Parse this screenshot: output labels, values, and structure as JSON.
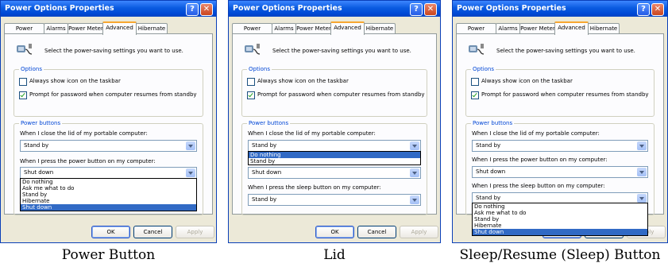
{
  "dialog_title": "Power Options Properties",
  "help_glyph": "?",
  "close_glyph": "✕",
  "tabs": [
    "Power Schemes",
    "Alarms",
    "Power Meter",
    "Advanced",
    "Hibernate"
  ],
  "active_tab": "Advanced",
  "intro_text": "Select the power-saving settings you want to use.",
  "options_label": "Options",
  "checkbox_taskbar": "Always show icon on the taskbar",
  "checkbox_password": "Prompt for password when computer resumes from standby",
  "power_buttons_label": "Power buttons",
  "lid_label": "When I close the lid of my portable computer:",
  "power_label": "When I press the power button on my computer:",
  "sleep_label": "When I press the sleep button on my computer:",
  "ok_label": "OK",
  "cancel_label": "Cancel",
  "apply_label": "Apply",
  "panels": [
    {
      "caption": "Power Button",
      "lid_value": "Stand by",
      "power_value": "Shut down",
      "dropdown_options": [
        "Do nothing",
        "Ask me what to do",
        "Stand by",
        "Hibernate",
        "Shut down"
      ],
      "dropdown_selected": "Shut down"
    },
    {
      "caption": "Lid",
      "lid_value": "Stand by",
      "power_value": "Shut down",
      "sleep_value": "Stand by",
      "dropdown_options": [
        "Do nothing",
        "Stand by"
      ],
      "dropdown_selected": "Do nothing"
    },
    {
      "caption": "Sleep/Resume (Sleep) Button",
      "lid_value": "Stand by",
      "power_value": "Shut down",
      "sleep_value": "Stand by",
      "dropdown_options": [
        "Do nothing",
        "Ask me what to do",
        "Stand by",
        "Hibernate",
        "Shut down"
      ],
      "dropdown_selected": "Shut down"
    }
  ]
}
